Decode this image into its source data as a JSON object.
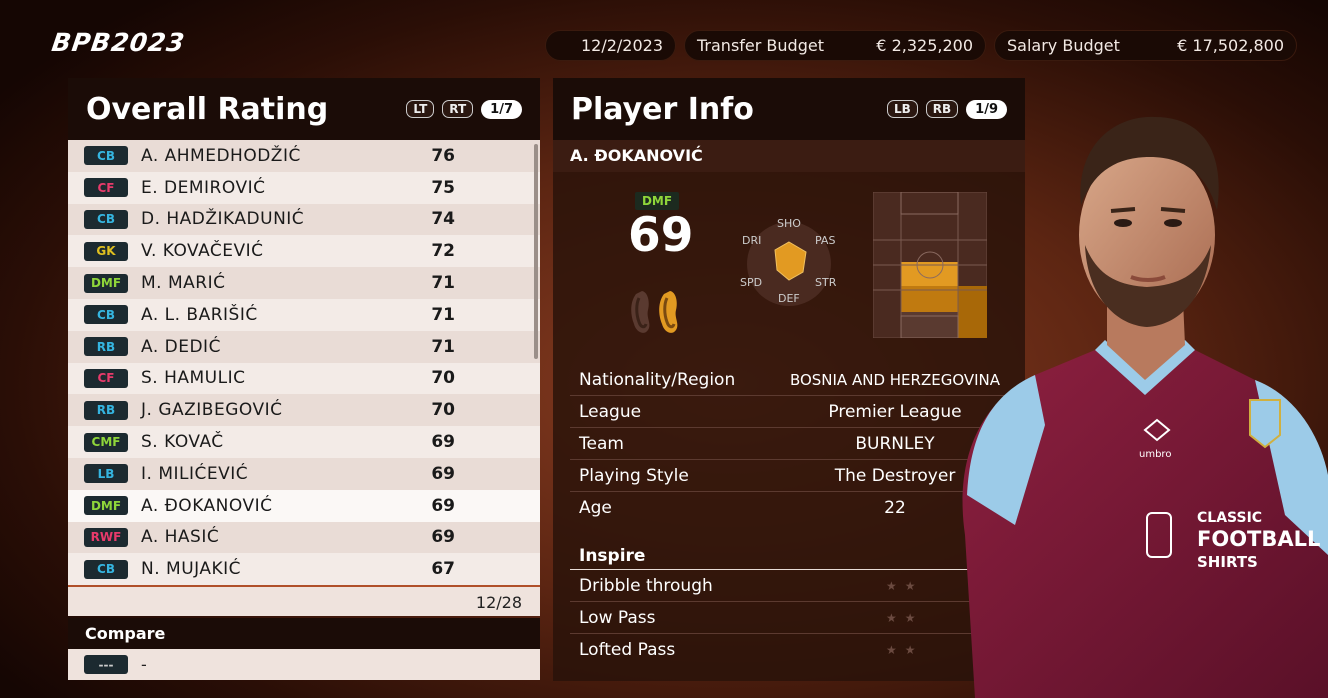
{
  "logo": "BPB2023",
  "header": {
    "date": "12/2/2023",
    "transfer_label": "Transfer Budget",
    "transfer_value": "€ 2,325,200",
    "salary_label": "Salary Budget",
    "salary_value": "€ 17,502,800"
  },
  "left_panel": {
    "title": "Overall Rating",
    "btn_lt": "LT",
    "btn_rt": "RT",
    "page": "1/7",
    "count": "12/28",
    "players": [
      {
        "pos": "CB",
        "name": "A. AHMEDHODŽIĆ",
        "rating": "76",
        "color": "#35b5e0"
      },
      {
        "pos": "CF",
        "name": "E. DEMIROVIĆ",
        "rating": "75",
        "color": "#e83a6b"
      },
      {
        "pos": "CB",
        "name": "D. HADŽIKADUNIĆ",
        "rating": "74",
        "color": "#35b5e0"
      },
      {
        "pos": "GK",
        "name": "V. KOVAČEVIĆ",
        "rating": "72",
        "color": "#e0c020"
      },
      {
        "pos": "DMF",
        "name": "M. MARIĆ",
        "rating": "71",
        "color": "#8fd63a"
      },
      {
        "pos": "CB",
        "name": "A. L. BARIŠIĆ",
        "rating": "71",
        "color": "#35b5e0"
      },
      {
        "pos": "RB",
        "name": "A. DEDIĆ",
        "rating": "71",
        "color": "#35b5e0"
      },
      {
        "pos": "CF",
        "name": "S. HAMULIC",
        "rating": "70",
        "color": "#e83a6b"
      },
      {
        "pos": "RB",
        "name": "J. GAZIBEGOVIĆ",
        "rating": "70",
        "color": "#35b5e0"
      },
      {
        "pos": "CMF",
        "name": "S. KOVAČ",
        "rating": "69",
        "color": "#8fd63a"
      },
      {
        "pos": "LB",
        "name": "I. MILIĆEVIĆ",
        "rating": "69",
        "color": "#35b5e0"
      },
      {
        "pos": "DMF",
        "name": "A. ĐOKANOVIĆ",
        "rating": "69",
        "color": "#8fd63a"
      },
      {
        "pos": "RWF",
        "name": "A. HASIĆ",
        "rating": "69",
        "color": "#e83a6b"
      },
      {
        "pos": "CB",
        "name": "N. MUJAKIĆ",
        "rating": "67",
        "color": "#35b5e0"
      }
    ],
    "compare_label": "Compare",
    "compare_pos": "---",
    "compare_value": "-"
  },
  "right_panel": {
    "title": "Player Info",
    "btn_lb": "LB",
    "btn_rb": "RB",
    "page": "1/9",
    "player_name": "A. ĐOKANOVIĆ",
    "position": "DMF",
    "rating": "69",
    "radar_labels": {
      "sho": "SHO",
      "pas": "PAS",
      "str": "STR",
      "def": "DEF",
      "spd": "SPD",
      "dri": "DRI"
    },
    "info": [
      {
        "key": "Nationality/Region",
        "value": "BOSNIA AND HERZEGOVINA"
      },
      {
        "key": "League",
        "value": "Premier League"
      },
      {
        "key": "Team",
        "value": "BURNLEY"
      },
      {
        "key": "Playing Style",
        "value": "The Destroyer"
      },
      {
        "key": "Age",
        "value": "22"
      }
    ],
    "inspire_title": "Inspire",
    "inspire": [
      {
        "key": "Dribble through",
        "stars": "★★"
      },
      {
        "key": "Low Pass",
        "stars": "★★"
      },
      {
        "key": "Lofted Pass",
        "stars": "★★"
      }
    ]
  },
  "shirt_sponsor": [
    "CLASSIC",
    "FOOTBALL",
    "SHIRTS"
  ],
  "shirt_brand": "umbro"
}
